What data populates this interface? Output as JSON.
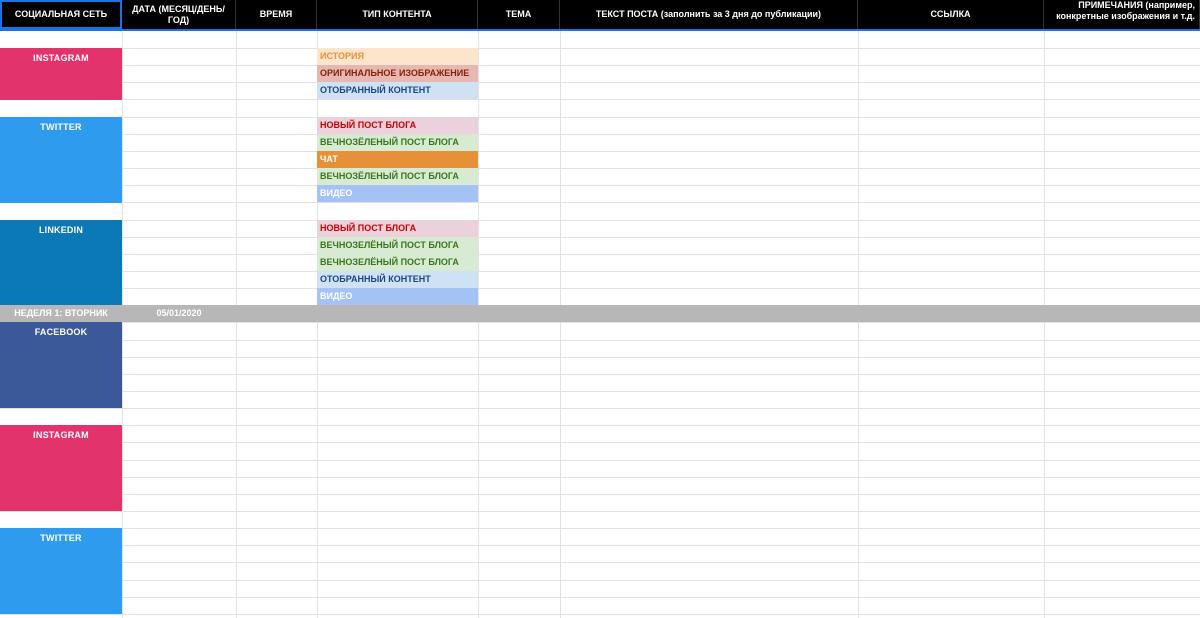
{
  "colors": {
    "instagram": "#e2336d",
    "twitter": "#2f9bef",
    "linkedin": "#0a79b5",
    "facebook": "#3b5998",
    "header_bg": "#000000",
    "week_bg": "#b7b7b7"
  },
  "header": {
    "network": "СОЦИАЛЬНАЯ СЕТЬ",
    "date": "ДАТА (МЕСЯЦ/ДЕНЬ/ГОД)",
    "time": "ВРЕМЯ",
    "content_type": "ТИП КОНТЕНТА",
    "topic": "ТЕМА",
    "post_text": "ТЕКСТ ПОСТА (заполнить за 3 дня до публикации)",
    "link": "ССЫЛКА",
    "notes": "ПРИМЕЧАНИЯ (например, конкретные изображения и т.д."
  },
  "networks": {
    "instagram_1": "INSTAGRAM",
    "twitter_1": "TWITTER",
    "linkedin_1": "LINKEDIN",
    "facebook_2": "FACEBOOK",
    "instagram_2": "INSTAGRAM",
    "twitter_2": "TWITTER"
  },
  "week": {
    "label": "НЕДЕЛЯ 1: ВТОРНИК",
    "date": "05/01/2020"
  },
  "content_types": [
    {
      "text": "ИСТОРИЯ",
      "bg": "#fce5cd",
      "fg": "#e69138"
    },
    {
      "text": "ОРИГИНАЛЬНОЕ ИЗОБРАЖЕНИЕ",
      "bg": "#e6b8af",
      "fg": "#85200c"
    },
    {
      "text": "ОТОБРАННЫЙ КОНТЕНТ",
      "bg": "#cfe2f3",
      "fg": "#1c4587"
    },
    {
      "text": "НОВЫЙ ПОСТ БЛОГА",
      "bg": "#ead1dc",
      "fg": "#cc0000"
    },
    {
      "text": "ВЕЧНОЗЁЛЕНЫЙ ПОСТ БЛОГА",
      "bg": "#d9ead3",
      "fg": "#38761d"
    },
    {
      "text": "ЧАТ",
      "bg": "#e69138",
      "fg": "#ffffff"
    },
    {
      "text": "ВЕЧНОЗЁЛЕНЫЙ ПОСТ БЛОГА",
      "bg": "#d9ead3",
      "fg": "#38761d"
    },
    {
      "text": "ВИДЕО",
      "bg": "#a4c2f4",
      "fg": "#ffffff"
    },
    {
      "text": "НОВЫЙ ПОСТ БЛОГА",
      "bg": "#ead1dc",
      "fg": "#cc0000"
    },
    {
      "text": "ВЕЧНОЗЕЛЁНЫЙ ПОСТ БЛОГА",
      "bg": "#d9ead3",
      "fg": "#38761d"
    },
    {
      "text": "ВЕЧНОЗЕЛЁНЫЙ ПОСТ БЛОГА",
      "bg": "#d9ead3",
      "fg": "#38761d"
    },
    {
      "text": "ОТОБРАННЫЙ КОНТЕНТ",
      "bg": "#cfe2f3",
      "fg": "#1c4587"
    },
    {
      "text": "ВИДЕО",
      "bg": "#a4c2f4",
      "fg": "#ffffff"
    }
  ]
}
